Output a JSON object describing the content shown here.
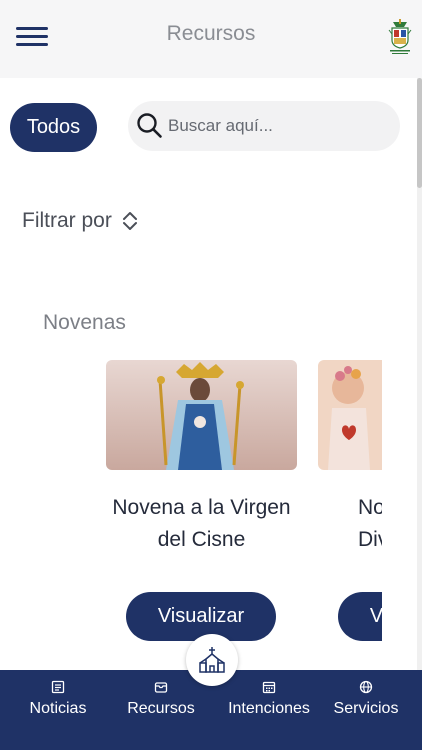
{
  "header": {
    "title": "Recursos",
    "menu_icon": "hamburger-menu-icon",
    "logo_icon": "diocese-crest-icon"
  },
  "filters": {
    "all_chip": "Todos",
    "search_placeholder": "Buscar aquí...",
    "filter_label": "Filtrar por",
    "filter_icon": "sort-chevrons-icon"
  },
  "section": {
    "title": "Novenas",
    "cards": [
      {
        "title": "Novena a la Virgen del Cisne",
        "button": "Visualizar"
      },
      {
        "title": "Novena al Divino Niño",
        "button": "Visualizar"
      }
    ]
  },
  "bottom_nav": {
    "items": [
      {
        "label": "Noticias",
        "icon": "newspaper-icon"
      },
      {
        "label": "Recursos",
        "icon": "folder-icon"
      },
      {
        "label": "Intenciones",
        "icon": "calendar-icon"
      },
      {
        "label": "Servicios",
        "icon": "globe-icon"
      }
    ],
    "center_icon": "church-icon"
  },
  "colors": {
    "primary": "#1f3266",
    "header_bg": "#f6f6f7",
    "search_bg": "#f2f2f3"
  }
}
